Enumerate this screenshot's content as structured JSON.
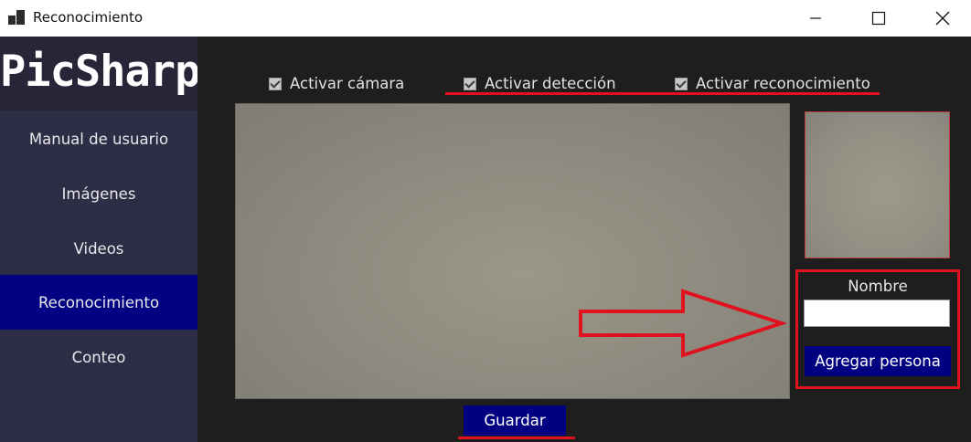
{
  "window": {
    "title": "Reconocimiento",
    "icons": [
      "app-icon",
      "minimize-icon",
      "maximize-icon",
      "close-icon"
    ]
  },
  "sidebar": {
    "logo": "PicSharp",
    "items": [
      {
        "label": "Manual de usuario",
        "active": false
      },
      {
        "label": "Imágenes",
        "active": false
      },
      {
        "label": "Videos",
        "active": false
      },
      {
        "label": "Reconocimiento",
        "active": true
      },
      {
        "label": "Conteo",
        "active": false
      }
    ],
    "colors": {
      "background": "#2d2d45",
      "active": "#020282"
    }
  },
  "options": {
    "camera": {
      "label": "Activar cámara",
      "checked": true
    },
    "detection": {
      "label": "Activar detección",
      "checked": true
    },
    "recognition": {
      "label": "Activar reconocimiento",
      "checked": true
    }
  },
  "form": {
    "name_label": "Nombre",
    "name_value": "",
    "add_button": "Agregar persona"
  },
  "save_button": "Guardar",
  "colors": {
    "button": "#000080",
    "highlight": "#e0121f",
    "main_bg": "#1e1e1e"
  }
}
